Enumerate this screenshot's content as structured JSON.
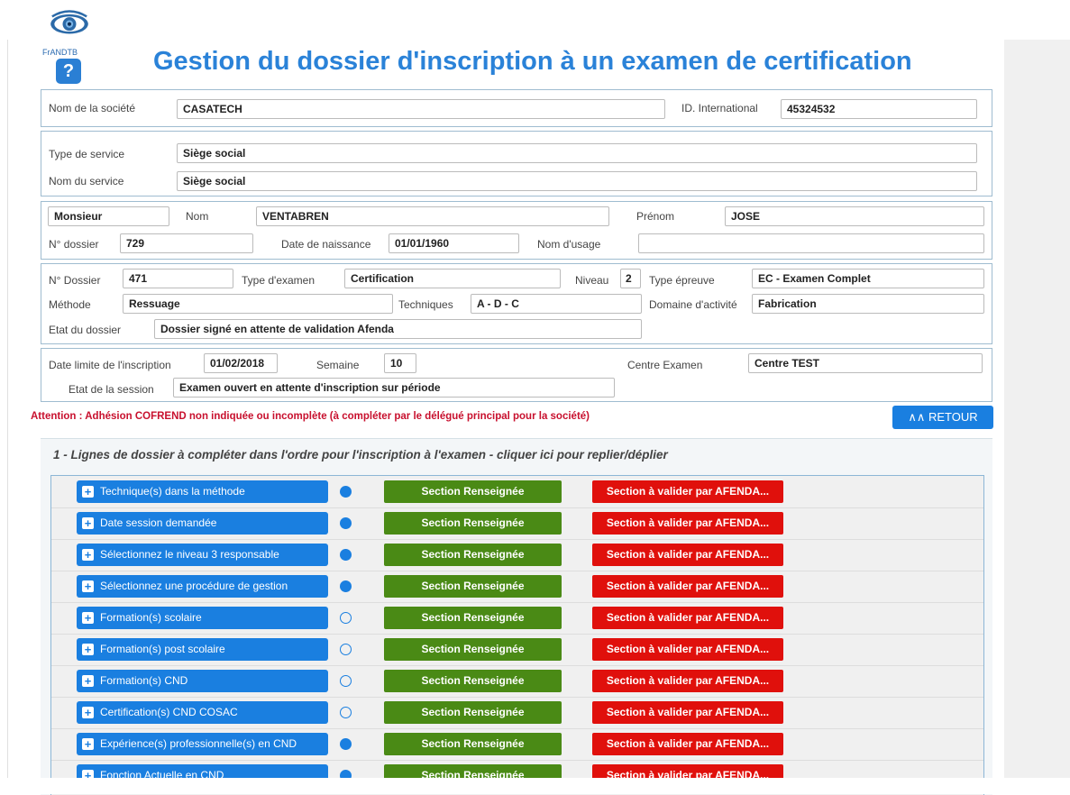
{
  "header": {
    "logo_text": "FrANDTB",
    "help_label": "?",
    "title": "Gestion du dossier d'inscription à un examen de certification"
  },
  "company": {
    "name_label": "Nom de la société",
    "name_value": "CASATECH",
    "id_label": "ID. International",
    "id_value": "45324532"
  },
  "service": {
    "type_label": "Type de service",
    "type_value": "Siège social",
    "name_label": "Nom du service",
    "name_value": "Siège social"
  },
  "person": {
    "civility": "Monsieur",
    "nom_label": "Nom",
    "nom_value": "VENTABREN",
    "prenom_label": "Prénom",
    "prenom_value": "JOSE",
    "dossier_label": "N° dossier",
    "dossier_value": "729",
    "birth_label": "Date de naissance",
    "birth_value": "01/01/1960",
    "usage_label": "Nom d'usage",
    "usage_value": ""
  },
  "exam": {
    "dossier_label": "N° Dossier",
    "dossier_value": "471",
    "type_label": "Type d'examen",
    "type_value": "Certification",
    "niveau_label": "Niveau",
    "niveau_value": "2",
    "epreuve_label": "Type épreuve",
    "epreuve_value": "EC - Examen Complet",
    "methode_label": "Méthode",
    "methode_value": "Ressuage",
    "techniques_label": "Techniques",
    "techniques_value": "A - D - C",
    "domaine_label": "Domaine d'activité",
    "domaine_value": "Fabrication",
    "etat_label": "Etat du dossier",
    "etat_value": "Dossier signé en attente de validation Afenda"
  },
  "session": {
    "date_label": "Date limite de l'inscription",
    "date_value": "01/02/2018",
    "semaine_label": "Semaine",
    "semaine_value": "10",
    "centre_label": "Centre Examen",
    "centre_value": "Centre TEST",
    "etat_label": "Etat de la session",
    "etat_value": "Examen ouvert en attente d'inscription sur période"
  },
  "warning": "Attention : Adhésion COFREND non indiquée ou incomplète (à compléter par le délégué principal pour la société)",
  "retour_label": "RETOUR",
  "retour_icon": "double-chevron-up-icon",
  "section": {
    "title": "1 - Lignes de dossier à compléter dans l'ordre pour l'inscription à l'examen - cliquer ici pour replier/déplier",
    "rows": [
      {
        "label": "Technique(s) dans la méthode",
        "dot": "filled",
        "status": "Section Renseignée",
        "validation": "Section à valider par AFENDA..."
      },
      {
        "label": "Date session demandée",
        "dot": "filled",
        "status": "Section Renseignée",
        "validation": "Section à valider par AFENDA..."
      },
      {
        "label": "Sélectionnez le niveau 3 responsable",
        "dot": "filled",
        "status": "Section Renseignée",
        "validation": "Section à valider par AFENDA..."
      },
      {
        "label": "Sélectionnez une procédure de gestion",
        "dot": "filled",
        "status": "Section Renseignée",
        "validation": "Section à valider par AFENDA..."
      },
      {
        "label": "Formation(s) scolaire",
        "dot": "empty",
        "status": "Section Renseignée",
        "validation": "Section à valider par AFENDA..."
      },
      {
        "label": "Formation(s) post scolaire",
        "dot": "empty",
        "status": "Section Renseignée",
        "validation": "Section à valider par AFENDA..."
      },
      {
        "label": "Formation(s) CND",
        "dot": "empty",
        "status": "Section Renseignée",
        "validation": "Section à valider par AFENDA..."
      },
      {
        "label": "Certification(s) CND COSAC",
        "dot": "empty",
        "status": "Section Renseignée",
        "validation": "Section à valider par AFENDA..."
      },
      {
        "label": "Expérience(s) professionnelle(s) en CND",
        "dot": "filled",
        "status": "Section Renseignée",
        "validation": "Section à valider par AFENDA..."
      },
      {
        "label": "Fonction Actuelle en CND",
        "dot": "filled",
        "status": "Section Renseignée",
        "validation": "Section à valider par AFENDA..."
      }
    ]
  },
  "colors": {
    "title_blue": "#2a82d8",
    "button_blue": "#1a7fe0",
    "green": "#4a8a15",
    "red": "#e0100c",
    "warning_red": "#c8102e"
  }
}
